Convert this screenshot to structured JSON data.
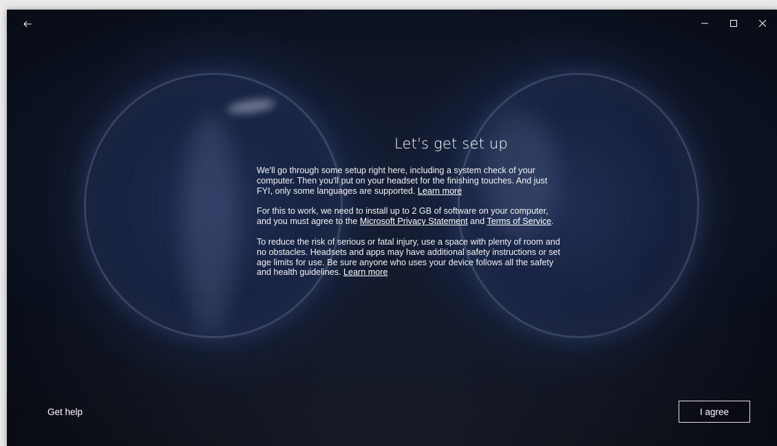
{
  "window": {
    "back_icon": "back-arrow-icon",
    "controls": {
      "minimize_icon": "minimize-icon",
      "maximize_icon": "maximize-icon",
      "close_icon": "close-icon"
    }
  },
  "main": {
    "title": "Let's get set up",
    "para1": {
      "text": "We'll go through some setup right here, including a system check of your computer. Then you'll put on your headset for the finishing touches. And just FYI, only some languages are supported.",
      "link": "Learn more"
    },
    "para2": {
      "text_before": "For this to work, we need to install up to 2 GB of software on your computer, and you must agree to the",
      "link_privacy": "Microsoft Privacy Statement",
      "text_middle": "and",
      "link_terms": "Terms of Service",
      "text_after": "."
    },
    "para3": {
      "text": "To reduce the risk of serious or fatal injury, use a space with plenty of room and no obstacles. Headsets and apps may have additional safety instructions or set age limits for use. Be sure anyone who uses your device follows all the safety and health guidelines.",
      "link": "Learn more"
    }
  },
  "footer": {
    "get_help": "Get help",
    "agree": "I agree"
  }
}
